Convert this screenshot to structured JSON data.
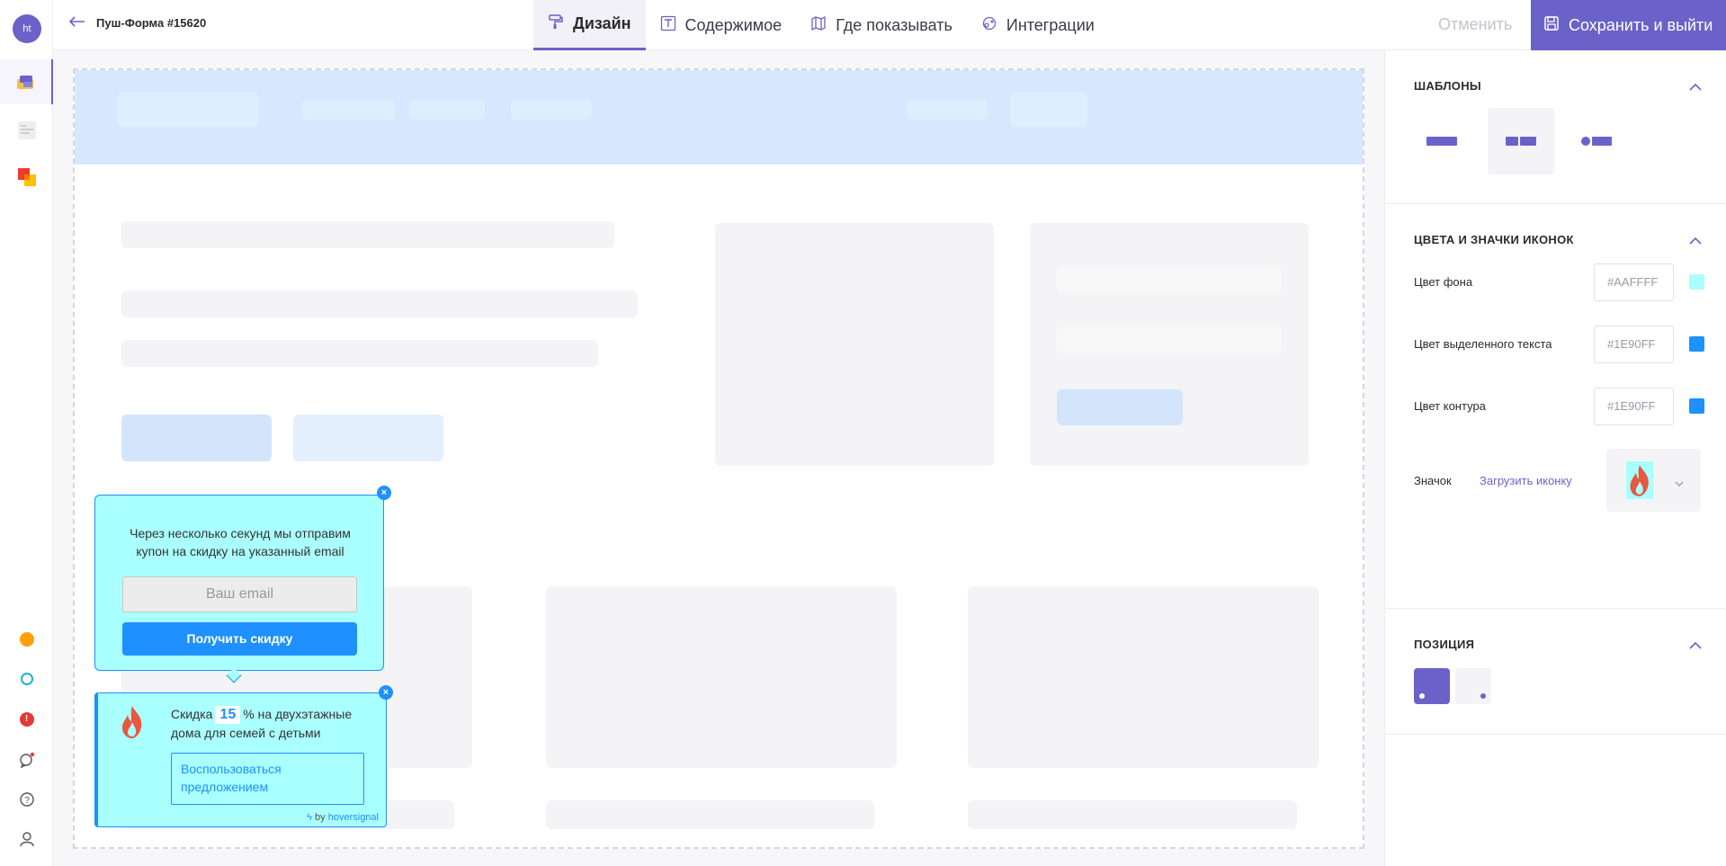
{
  "rail": {
    "avatar_initials": "ht",
    "items": [
      "widgets-icon",
      "pages-icon",
      "apps-icon"
    ],
    "bottom": [
      "status-orange-icon",
      "status-teal-icon",
      "alert-icon",
      "chat-icon",
      "help-icon",
      "user-icon"
    ]
  },
  "header": {
    "back_title": "Пуш-Форма #15620",
    "tabs": [
      {
        "label": "Дизайн",
        "icon": "paint-roller-icon"
      },
      {
        "label": "Содержимое",
        "icon": "text-icon"
      },
      {
        "label": "Где показывать",
        "icon": "map-icon"
      },
      {
        "label": "Интеграции",
        "icon": "integrations-icon"
      }
    ],
    "cancel_label": "Отменить",
    "save_label": "Сохранить и выйти"
  },
  "popup_form": {
    "text": "Через несколько секунд мы отправим купон на скидку на указанный email",
    "email_placeholder": "Ваш email",
    "button_label": "Получить скидку"
  },
  "popup_offer": {
    "text_before": "Скидка",
    "percent": "15",
    "text_after": "% на двухэтажные дома для семей с детьми",
    "button_label": "Воспользоваться предложением",
    "by_label": "by",
    "brand": "hoversignal"
  },
  "panel": {
    "templates_title": "ШАБЛОНЫ",
    "colors_title": "ЦВЕТА И ЗНАЧКИ ИКОНОК",
    "colors": [
      {
        "label": "Цвет фона",
        "value": "#AAFFFF",
        "swatch": "#aaffff"
      },
      {
        "label": "Цвет выделенного текста",
        "value": "#1E90FF",
        "swatch": "#1e90ff"
      },
      {
        "label": "Цвет контура",
        "value": "#1E90FF",
        "swatch": "#1e90ff"
      }
    ],
    "icon_label": "Значок",
    "upload_label": "Загрузить иконку",
    "position_title": "ПОЗИЦИЯ"
  },
  "accent_color": "#6b62c9"
}
